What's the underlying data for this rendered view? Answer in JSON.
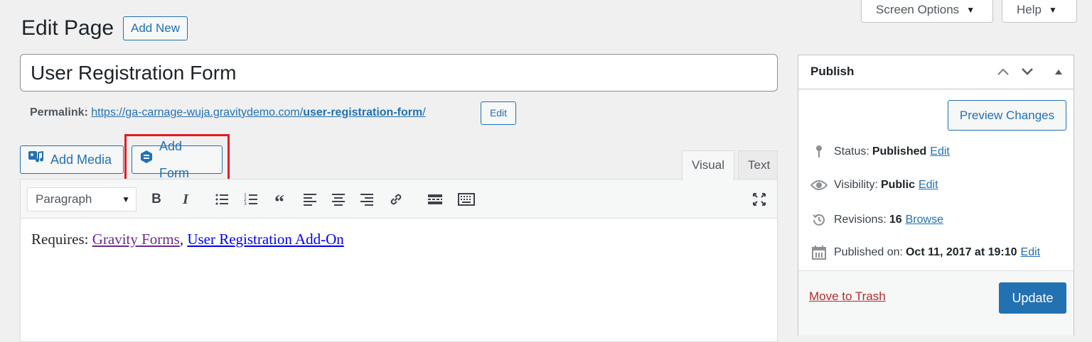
{
  "header": {
    "title": "Edit Page",
    "add_new_label": "Add New",
    "screen_options_label": "Screen Options",
    "help_label": "Help"
  },
  "post": {
    "title": "User Registration Form",
    "permalink_label": "Permalink:",
    "permalink_base": "https://ga-carnage-wuja.gravitydemo.com/",
    "permalink_slug": "user-registration-form",
    "permalink_trail": "/",
    "permalink_edit_label": "Edit"
  },
  "media_buttons": {
    "add_media_label": "Add Media",
    "add_form_label": "Add Form"
  },
  "editor_tabs": {
    "visual": "Visual",
    "text": "Text"
  },
  "toolbar": {
    "format_value": "Paragraph",
    "buttons": [
      "bold-icon",
      "italic-icon",
      "bulleted-list-icon",
      "numbered-list-icon",
      "blockquote-icon",
      "align-left-icon",
      "align-center-icon",
      "align-right-icon",
      "link-icon",
      "read-more-icon",
      "toolbar-toggle-icon",
      "fullscreen-icon"
    ]
  },
  "content": {
    "prefix": "Requires: ",
    "link1": "Gravity Forms",
    "separator": ", ",
    "link2": "User Registration Add-On"
  },
  "publish": {
    "title": "Publish",
    "preview_label": "Preview Changes",
    "status_label": "Status:",
    "status_value": "Published",
    "status_edit": "Edit",
    "visibility_label": "Visibility:",
    "visibility_value": "Public",
    "visibility_edit": "Edit",
    "revisions_label": "Revisions:",
    "revisions_value": "16",
    "revisions_browse": "Browse",
    "published_label": "Published on:",
    "published_value": "Oct 11, 2017 at 19:10",
    "published_edit": "Edit",
    "trash_label": "Move to Trash",
    "update_label": "Update"
  },
  "colors": {
    "accent": "#2271b1",
    "highlight": "#e21b23",
    "trash": "#b32d2e",
    "background": "#f0f0f1"
  }
}
